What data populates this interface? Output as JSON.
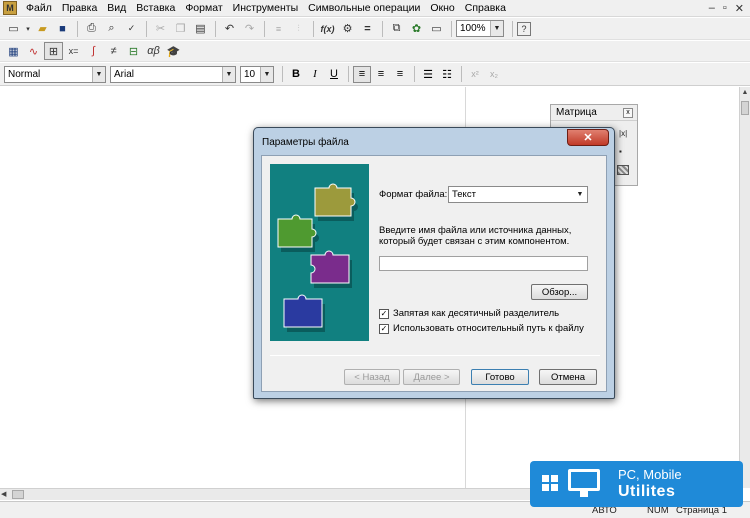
{
  "menu": {
    "items": [
      "Файл",
      "Правка",
      "Вид",
      "Вставка",
      "Формат",
      "Инструменты",
      "Символьные операции",
      "Окно",
      "Справка"
    ]
  },
  "toolbar": {
    "zoom": "100%",
    "style": "Normal",
    "font": "Arial",
    "size": "10",
    "bold": "B",
    "italic": "I",
    "underline": "U"
  },
  "matrix_palette": {
    "title": "Матрица"
  },
  "dialog": {
    "title": "Параметры файла",
    "close": "✕",
    "format_label": "Формат файла:",
    "format_value": "Текст",
    "instruction_line1": "Введите имя файла или источника данных,",
    "instruction_line2": "который будет связан с этим компонентом.",
    "filename_value": "",
    "browse": "Обзор...",
    "checkbox_decimal": "Запятая как десятичный разделитель",
    "checkbox_relative": "Использовать относительный путь к файлу",
    "back": "< Назад",
    "next": "Далее >",
    "finish": "Готово",
    "cancel": "Отмена"
  },
  "status": {
    "auto": "АВТО",
    "num": "NUM",
    "page": "Страница 1"
  },
  "watermark": {
    "line1": "PC, Mobile",
    "line2": "Utilites"
  }
}
